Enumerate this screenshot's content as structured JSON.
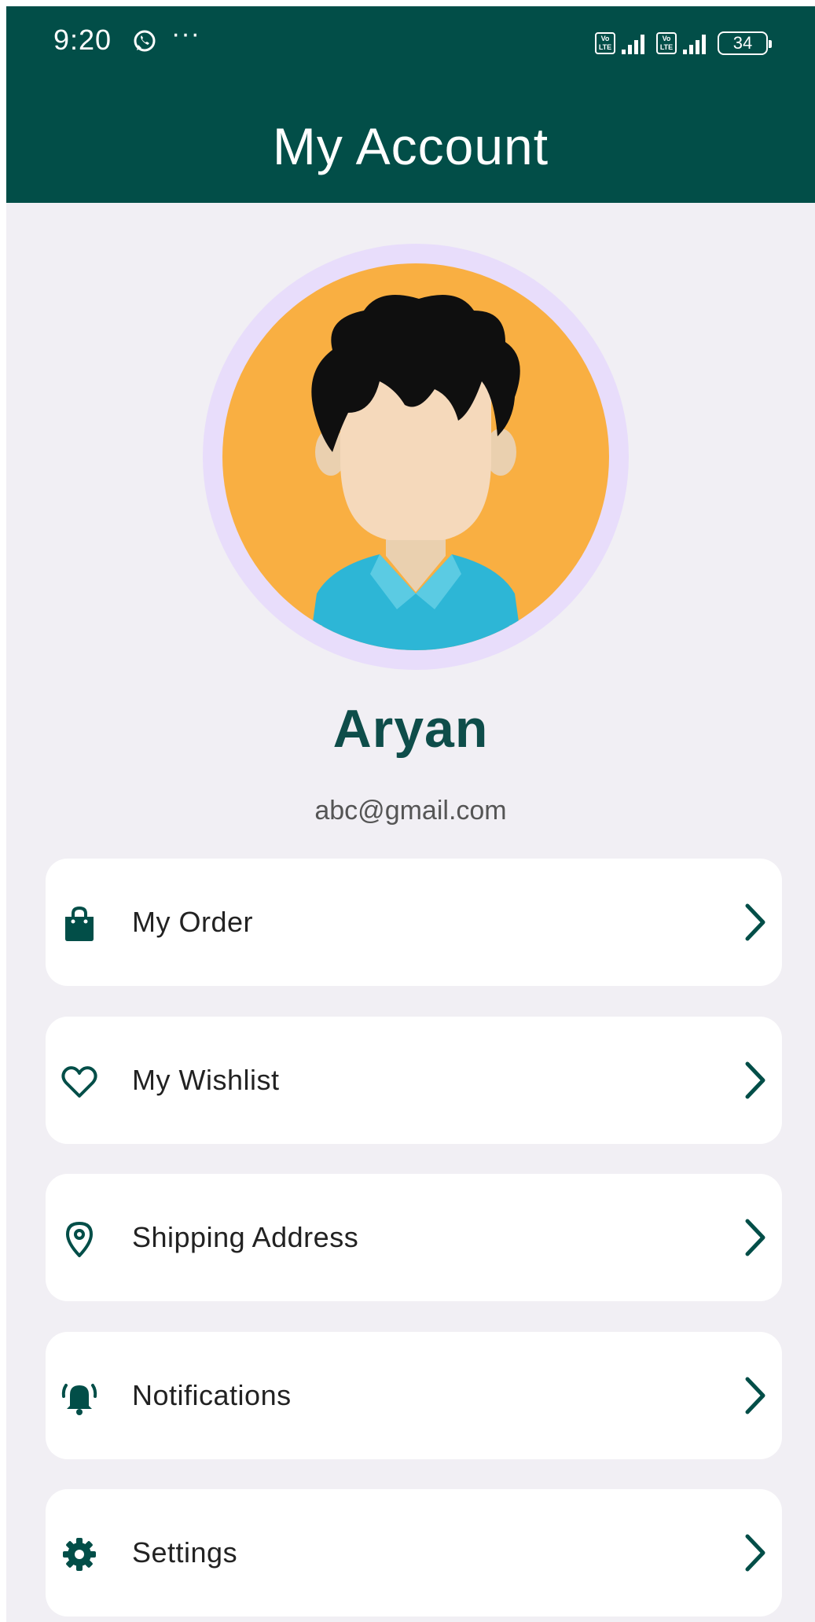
{
  "status_bar": {
    "time": "9:20",
    "overflow": "···",
    "lte_top": "Vo",
    "lte_bottom": "LTE",
    "battery": "34",
    "icons": [
      "whatsapp-icon",
      "signal-icon",
      "battery-icon"
    ]
  },
  "header": {
    "title": "My Account",
    "background_color": "#024E48"
  },
  "profile": {
    "name": "Aryan",
    "email": "abc@gmail.com",
    "avatar_icon": "user-avatar"
  },
  "menu": [
    {
      "label": "My Order",
      "icon": "shopping-bag-icon"
    },
    {
      "label": "My Wishlist",
      "icon": "heart-icon"
    },
    {
      "label": "Shipping Address",
      "icon": "location-pin-icon"
    },
    {
      "label": "Notifications",
      "icon": "bell-icon"
    },
    {
      "label": "Settings",
      "icon": "gear-icon"
    }
  ],
  "colors": {
    "primary": "#024E48",
    "background": "#F1EFF4",
    "avatar_ring": "#E8DDFB",
    "avatar_bg": "#F9AF42"
  }
}
